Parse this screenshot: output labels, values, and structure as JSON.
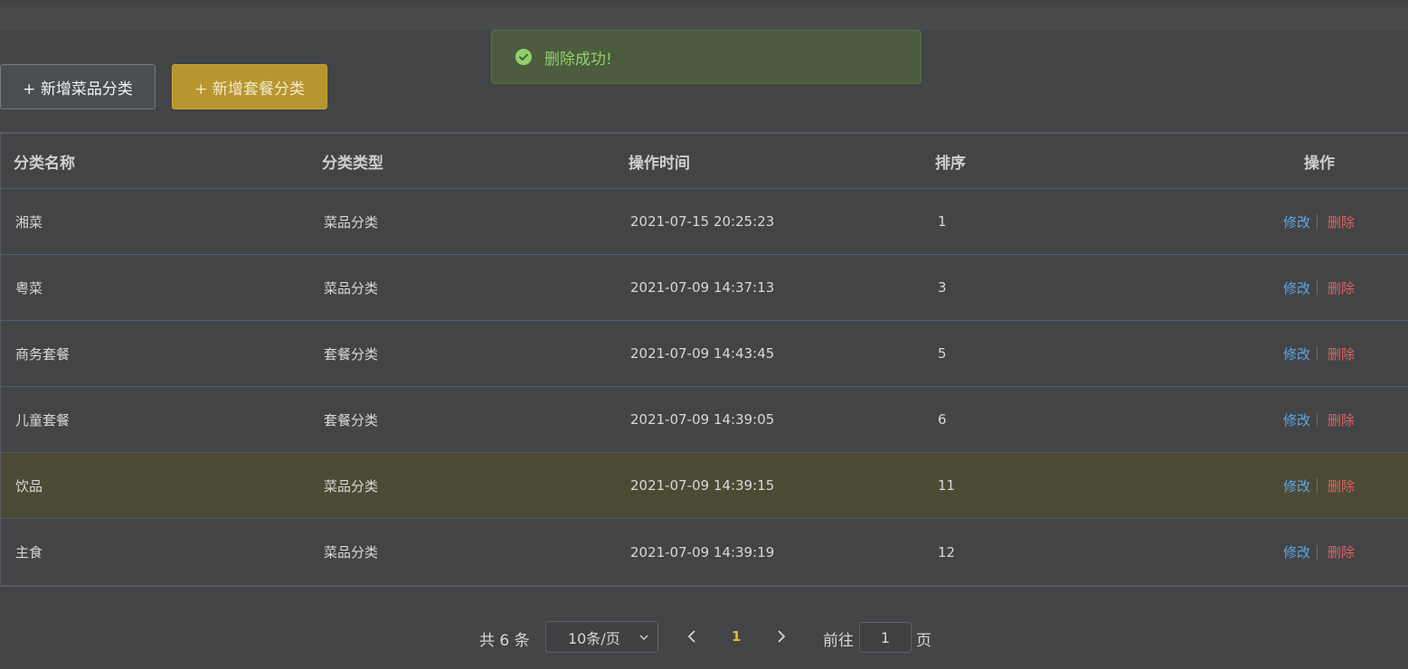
{
  "toolbar": {
    "add_dish_category": "+ 新增菜品分类",
    "add_combo_category": "+ 新增套餐分类"
  },
  "toast": {
    "message": "删除成功!",
    "type": "success"
  },
  "table": {
    "headers": {
      "name": "分类名称",
      "type": "分类类型",
      "time": "操作时间",
      "sort": "排序",
      "ops": "操作"
    },
    "rows": [
      {
        "name": "湘菜",
        "type": "菜品分类",
        "time": "2021-07-15 20:25:23",
        "sort": "1",
        "edit": "修改",
        "delete": "删除"
      },
      {
        "name": "粤菜",
        "type": "菜品分类",
        "time": "2021-07-09 14:37:13",
        "sort": "3",
        "edit": "修改",
        "delete": "删除"
      },
      {
        "name": "商务套餐",
        "type": "套餐分类",
        "time": "2021-07-09 14:43:45",
        "sort": "5",
        "edit": "修改",
        "delete": "删除"
      },
      {
        "name": "儿童套餐",
        "type": "套餐分类",
        "time": "2021-07-09 14:39:05",
        "sort": "6",
        "edit": "修改",
        "delete": "删除"
      },
      {
        "name": "饮品",
        "type": "菜品分类",
        "time": "2021-07-09 14:39:15",
        "sort": "11",
        "edit": "修改",
        "delete": "删除"
      },
      {
        "name": "主食",
        "type": "菜品分类",
        "time": "2021-07-09 14:39:19",
        "sort": "12",
        "edit": "修改",
        "delete": "删除"
      }
    ]
  },
  "pagination": {
    "total_label": "共 6 条",
    "page_size": "10条/页",
    "current_page": "1",
    "goto_label": "前往",
    "goto_value": "1",
    "page_suffix": "页"
  },
  "colors": {
    "background": "#434446",
    "accent": "#b8962f",
    "success": "#8fd16a",
    "link": "#5ea6e6",
    "danger": "#e0635f",
    "highlight_row": "#4b4a35"
  },
  "icons": {
    "toast": "check-circle-icon",
    "page_size": "chevron-down-icon",
    "prev": "chevron-left-icon",
    "next": "chevron-right-icon"
  }
}
